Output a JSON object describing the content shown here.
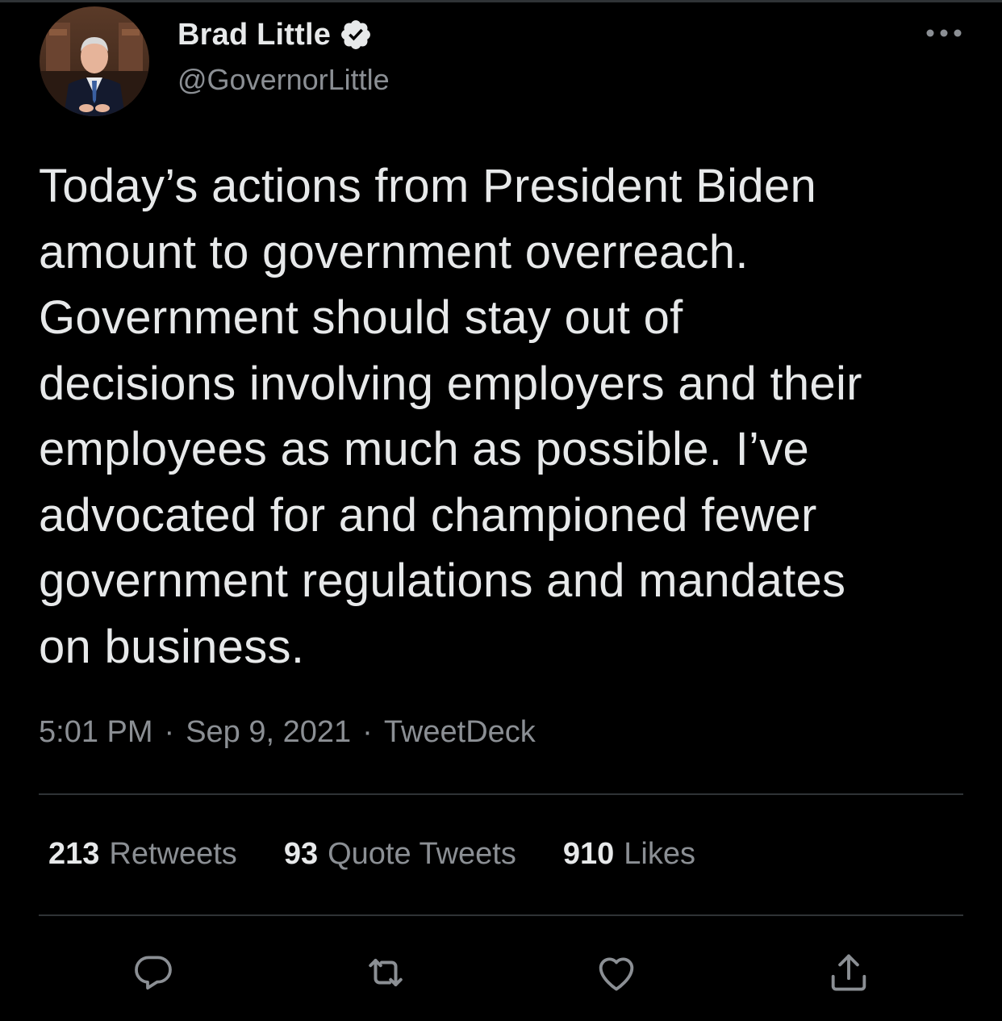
{
  "author": {
    "name": "Brad Little",
    "handle": "@GovernorLittle",
    "verified": true,
    "avatar_icon": "profile-photo"
  },
  "tweet": {
    "text": "Today’s actions from President Biden\namount to government overreach.\nGovernment should stay out of\ndecisions involving employers and their\nemployees as much as possible. I’ve\nadvocated for and championed fewer\ngovernment regulations and mandates\non business."
  },
  "meta": {
    "time": "5:01 PM",
    "separator": "·",
    "date": "Sep 9, 2021",
    "source": "TweetDeck"
  },
  "stats": {
    "retweets": {
      "count": "213",
      "label": "Retweets"
    },
    "quote_tweets": {
      "count": "93",
      "label": "Quote Tweets"
    },
    "likes": {
      "count": "910",
      "label": "Likes"
    }
  },
  "actions": {
    "reply_icon": "reply-icon",
    "retweet_icon": "retweet-icon",
    "like_icon": "heart-icon",
    "share_icon": "share-icon",
    "more_icon": "more-icon"
  },
  "colors": {
    "background": "#000000",
    "text_primary": "#e7e9ea",
    "text_secondary": "#8b8f94",
    "divider": "#2f3336"
  }
}
